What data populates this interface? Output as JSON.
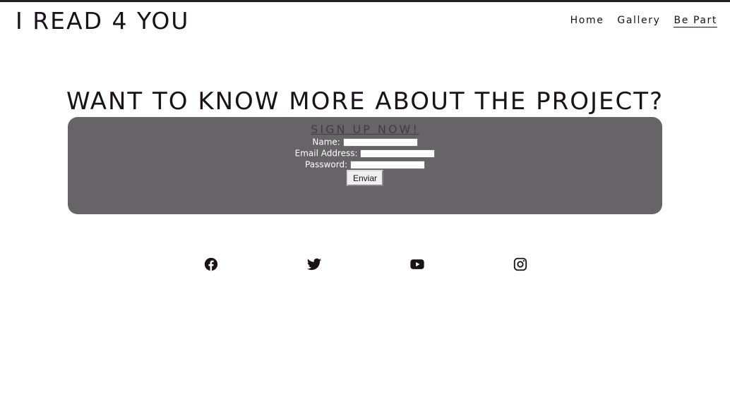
{
  "header": {
    "logo": "I READ 4 YOU",
    "nav": [
      {
        "label": "Home"
      },
      {
        "label": "Gallery"
      },
      {
        "label": "Be Part"
      }
    ]
  },
  "main": {
    "headline": "WANT TO KNOW MORE ABOUT THE PROJECT?",
    "form": {
      "title": "SIGN UP NOW!",
      "name_label": "Name:",
      "name_value": "",
      "email_label": "Email Address:",
      "email_value": "",
      "password_label": "Password:",
      "password_value": "",
      "submit_label": "Enviar"
    }
  },
  "footer": {
    "social": [
      {
        "icon": "facebook-icon"
      },
      {
        "icon": "twitter-icon"
      },
      {
        "icon": "youtube-icon"
      },
      {
        "icon": "instagram-icon"
      }
    ]
  },
  "colors": {
    "text": "#1a1216",
    "panel": "#666466",
    "panel_title": "#3f3d40"
  }
}
